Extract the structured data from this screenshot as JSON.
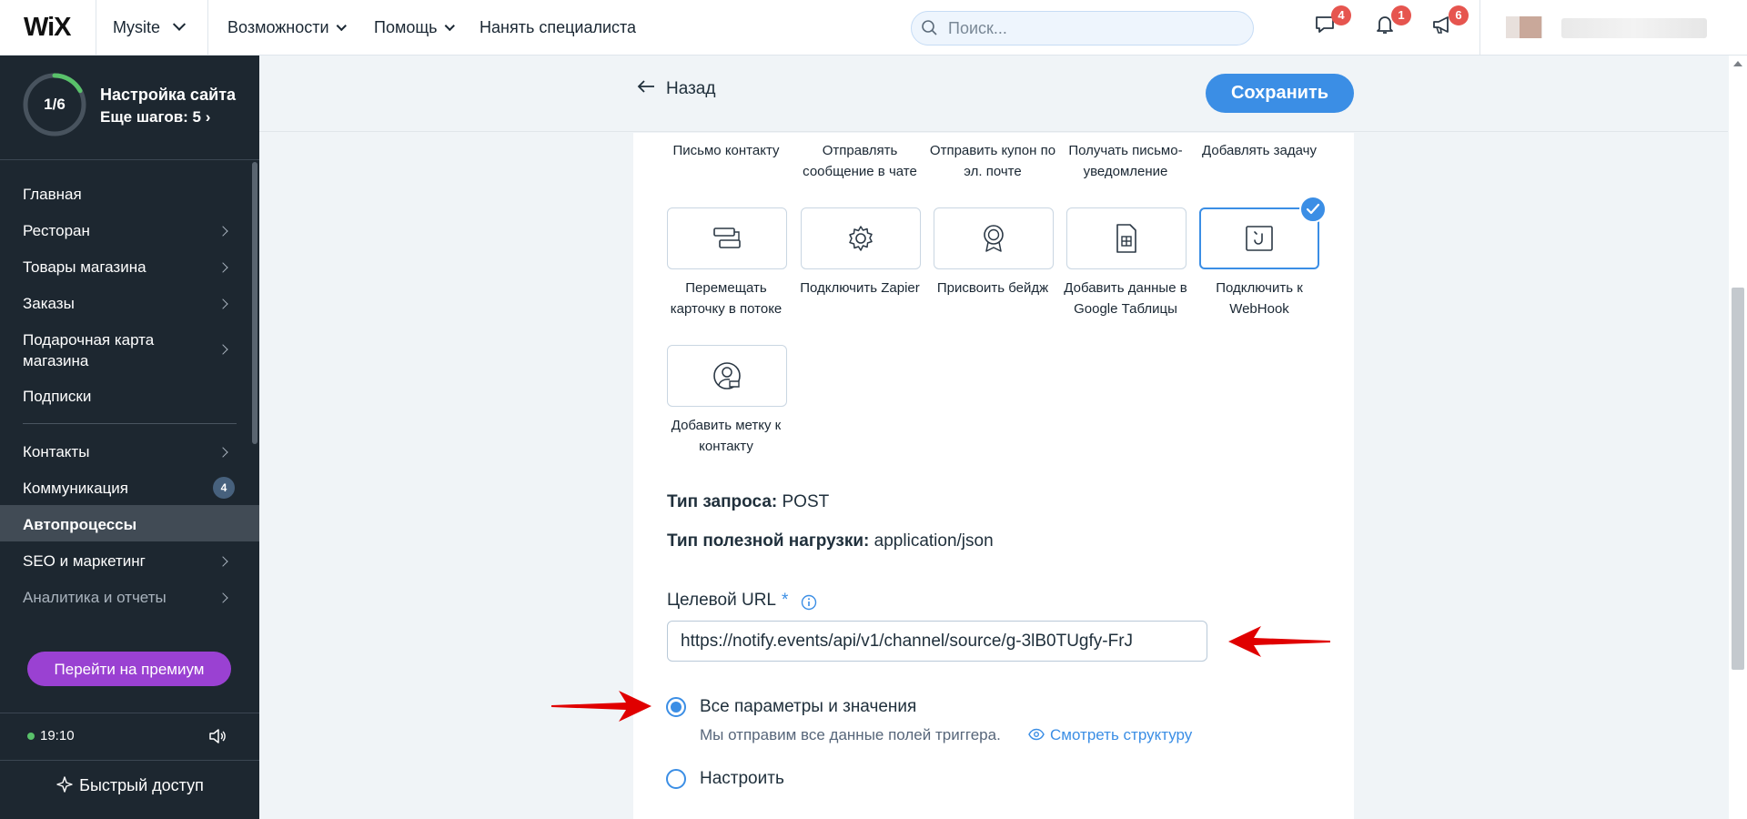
{
  "topbar": {
    "logo": "WiX",
    "site_name": "Mysite",
    "nav": [
      "Возможности",
      "Помощь",
      "Нанять специалиста"
    ],
    "search_placeholder": "Поиск...",
    "notifications": [
      {
        "icon": "chat-icon",
        "count": "4"
      },
      {
        "icon": "bell-icon",
        "count": "1"
      },
      {
        "icon": "megaphone-icon",
        "count": "6"
      }
    ]
  },
  "sidebar": {
    "progress": "1/6",
    "progress_fraction": 0.17,
    "setup_title": "Настройка сайта",
    "setup_steps": "Еще шагов: 5",
    "items": [
      {
        "label": "Главная",
        "chevron": false
      },
      {
        "label": "Ресторан",
        "chevron": true
      },
      {
        "label": "Товары магазина",
        "chevron": true
      },
      {
        "label": "Заказы",
        "chevron": true
      },
      {
        "label": "Подарочная карта магазина",
        "chevron": true
      },
      {
        "label": "Подписки",
        "chevron": false
      },
      {
        "label": "Контакты",
        "chevron": true
      },
      {
        "label": "Коммуникация",
        "badge": "4"
      },
      {
        "label": "Автопроцессы",
        "active": true
      },
      {
        "label": "SEO и маркетинг",
        "chevron": true
      },
      {
        "label": "Аналитика и отчеты",
        "chevron": true
      }
    ],
    "premium_button": "Перейти на премиум",
    "time": "19:10",
    "quick_access": "Быстрый доступ"
  },
  "header": {
    "back_label": "Назад",
    "save_label": "Сохранить"
  },
  "actions": {
    "top_row_labels": [
      "Письмо контакту",
      "Отправлять сообщение в чате",
      "Отправить купон по эл. почте",
      "Получать письмо-уведомление",
      "Добавлять задачу"
    ],
    "tiles": [
      {
        "label": "Перемещать карточку в потоке",
        "icon": "move-card-icon"
      },
      {
        "label": "Подключить Zapier",
        "icon": "gear-icon"
      },
      {
        "label": "Присвоить бейдж",
        "icon": "badge-icon"
      },
      {
        "label": "Добавить данные в Google Таблицы",
        "icon": "sheets-icon"
      },
      {
        "label": "Подключить к WebHook",
        "icon": "webhook-icon",
        "selected": true
      },
      {
        "label": "Добавить метку к контакту",
        "icon": "contact-tag-icon"
      }
    ]
  },
  "webhook": {
    "request_type_label": "Тип запроса:",
    "request_type_value": "POST",
    "payload_type_label": "Тип полезной нагрузки:",
    "payload_type_value": "application/json",
    "url_label": "Целевой URL",
    "url_required_mark": "*",
    "url_value": "https://notify.events/api/v1/channel/source/g-3lB0TUgfy-FrJ",
    "options": [
      {
        "label": "Все параметры и значения",
        "checked": true
      },
      {
        "label": "Настроить",
        "checked": false
      }
    ],
    "option_note": "Мы отправим все данные полей триггера.",
    "view_structure": "Смотреть структуру"
  },
  "colors": {
    "accent": "#3b8ee5",
    "sidebar_bg": "#1d2730",
    "premium": "#9a41d2",
    "badge_red": "#e6554f",
    "annotation_arrow": "#e00000"
  }
}
